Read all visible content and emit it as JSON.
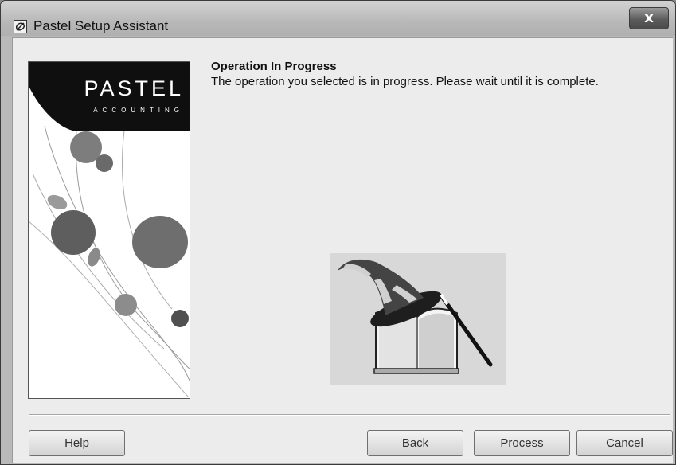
{
  "window": {
    "title": "Pastel Setup Assistant",
    "close_label": "x"
  },
  "brand": {
    "name": "PASTEL",
    "tagline": "ACCOUNTING"
  },
  "content": {
    "heading": "Operation In Progress",
    "description": "The operation you selected is in progress. Please wait until it is complete."
  },
  "buttons": {
    "help": "Help",
    "back": "Back",
    "process": "Process",
    "cancel": "Cancel"
  },
  "icons": {
    "app": "pastel-logo-icon",
    "wizard": "wizard-hat-book-icon",
    "close": "close-icon"
  }
}
